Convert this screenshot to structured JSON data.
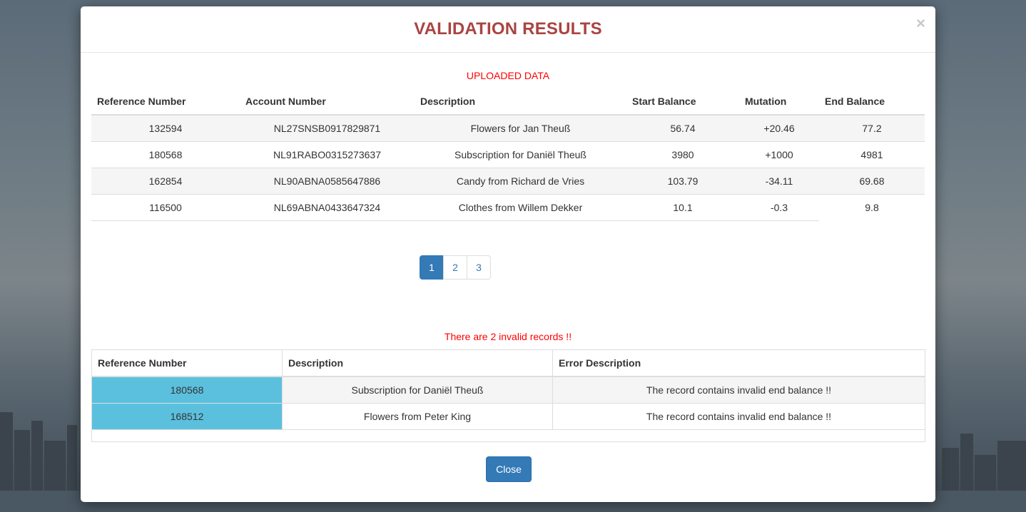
{
  "modal": {
    "title": "VALIDATION RESULTS",
    "close_symbol": "×"
  },
  "uploaded": {
    "label": "UPLOADED DATA",
    "columns": [
      "Reference Number",
      "Account Number",
      "Description",
      "Start Balance",
      "Mutation",
      "End Balance"
    ],
    "rows": [
      [
        "132594",
        "NL27SNSB0917829871",
        "Flowers for Jan Theuß",
        "56.74",
        "+20.46",
        "77.2"
      ],
      [
        "180568",
        "NL91RABO0315273637",
        "Subscription for Daniël Theuß",
        "3980",
        "+1000",
        "4981"
      ],
      [
        "162854",
        "NL90ABNA0585647886",
        "Candy from Richard de Vries",
        "103.79",
        "-34.11",
        "69.68"
      ],
      [
        "116500",
        "NL69ABNA0433647324",
        "Clothes from Willem Dekker",
        "10.1",
        "-0.3",
        "9.8"
      ]
    ]
  },
  "pagination": {
    "pages": [
      "1",
      "2",
      "3"
    ],
    "active": "1"
  },
  "invalid": {
    "label": "There are 2 invalid records !!",
    "columns": [
      "Reference Number",
      "Description",
      "Error Description"
    ],
    "rows": [
      [
        "180568",
        "Subscription for Daniël Theuß",
        "The record contains invalid end balance !!"
      ],
      [
        "168512",
        "Flowers from Peter King",
        "The record contains invalid end balance !!"
      ]
    ]
  },
  "footer": {
    "close_label": "Close"
  },
  "colors": {
    "title": "#a94442",
    "section_label": "#ff0000",
    "primary": "#337ab7",
    "invalid_ref_bg": "#5bc0de"
  }
}
